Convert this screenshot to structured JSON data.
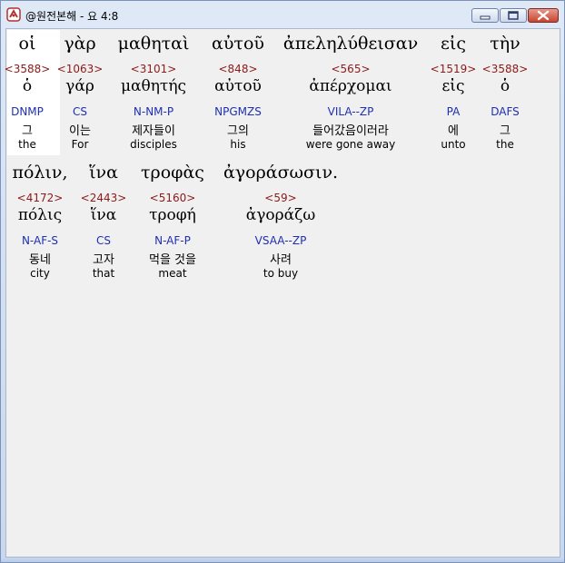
{
  "window": {
    "title": "@원전본해 - 요 4:8",
    "icon": "app-logo-icon",
    "controls": [
      "minimize-icon",
      "maximize-icon",
      "close-icon"
    ],
    "accent_close": "#c8452f"
  },
  "verse": {
    "row1": [
      {
        "greek": "οἱ",
        "strongs": "<3588>",
        "lemma": "ὁ",
        "parse": "DNMP",
        "korean": "그",
        "english": "the"
      },
      {
        "greek": "γὰρ",
        "strongs": "<1063>",
        "lemma": "γάρ",
        "parse": "CS",
        "korean": "이는",
        "english": "For"
      },
      {
        "greek": "μαθηταὶ",
        "strongs": "<3101>",
        "lemma": "μαθητής",
        "parse": "N-NM-P",
        "korean": "제자들이",
        "english": "disciples"
      },
      {
        "greek": "αὐτοῦ",
        "strongs": "<848>",
        "lemma": "αὐτοῦ",
        "parse": "NPGMZS",
        "korean": "그의",
        "english": "his"
      },
      {
        "greek": "ἀπεληλύθεισαν",
        "strongs": "<565>",
        "lemma": "ἀπέρχομαι",
        "parse": "VILA--ZP",
        "korean": "들어갔음이러라",
        "english": "were gone away"
      },
      {
        "greek": "εἰς",
        "strongs": "<1519>",
        "lemma": "εἰς",
        "parse": "PA",
        "korean": "에",
        "english": "unto"
      },
      {
        "greek": "τὴν",
        "strongs": "<3588>",
        "lemma": "ὁ",
        "parse": "DAFS",
        "korean": "그",
        "english": "the"
      }
    ],
    "row2": [
      {
        "greek": "πόλιν,",
        "strongs": "<4172>",
        "lemma": "πόλις",
        "parse": "N-AF-S",
        "korean": "동네",
        "english": "city"
      },
      {
        "greek": "ἵνα",
        "strongs": "<2443>",
        "lemma": "ἵνα",
        "parse": "CS",
        "korean": "고자",
        "english": "that"
      },
      {
        "greek": "τροφὰς",
        "strongs": "<5160>",
        "lemma": "τροφή",
        "parse": "N-AF-P",
        "korean": "먹을 것을",
        "english": "meat"
      },
      {
        "greek": "ἀγοράσωσιν.",
        "strongs": "<59>",
        "lemma": "ἀγοράζω",
        "parse": "VSAA--ZP",
        "korean": "사려",
        "english": "to buy"
      }
    ]
  },
  "colors": {
    "strongs": "#8b1a1a",
    "parse": "#1f2fb0",
    "highlight": "#ffffff",
    "background": "#f0f0f0"
  }
}
